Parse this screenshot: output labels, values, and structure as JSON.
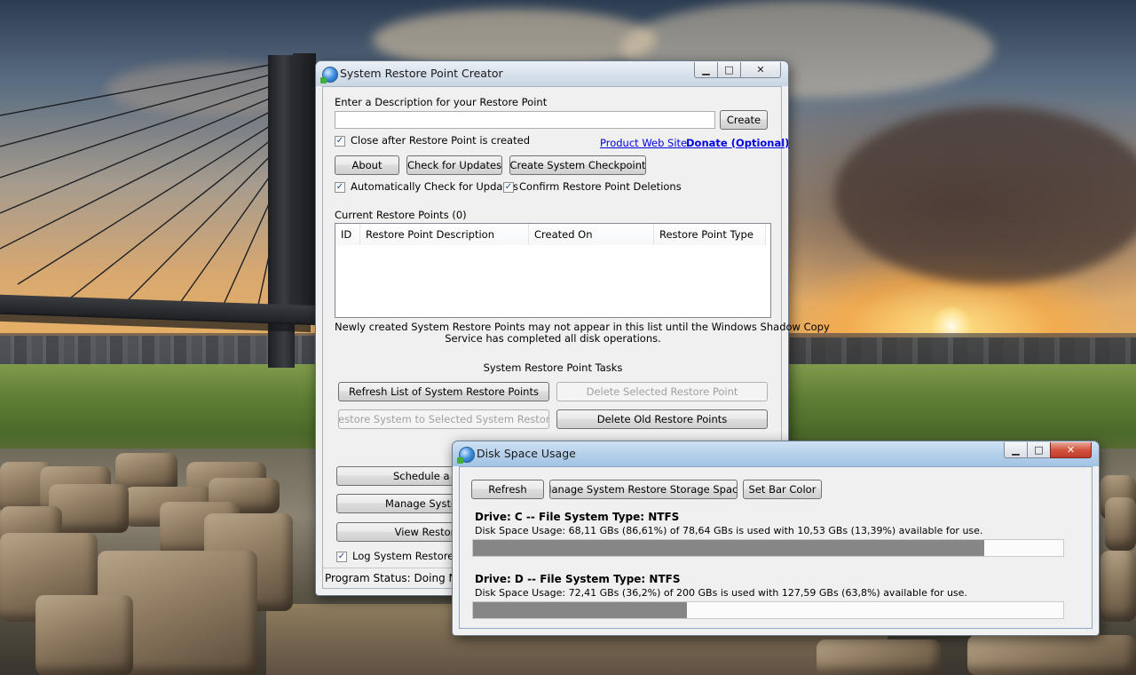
{
  "main_window": {
    "title": "System Restore Point Creator",
    "min_glyph": "▁",
    "max_glyph": "□",
    "close_glyph": "✕",
    "description_label": "Enter a Description for your Restore Point",
    "description_value": "",
    "create_button": "Create",
    "close_after_label": "Close after Restore Point is created",
    "close_after_checked": true,
    "product_link": "Product Web Site",
    "donate_link": "Donate (Optional)",
    "about_button": "About",
    "check_updates_button": "Check for Updates",
    "create_checkpoint_button": "Create System Checkpoint",
    "auto_check_label": "Automatically Check for Updates",
    "auto_check_checked": true,
    "confirm_delete_label": "Confirm Restore Point Deletions",
    "confirm_delete_checked": true,
    "current_points_label": "Current Restore Points (0)",
    "columns": [
      "ID",
      "Restore Point Description",
      "Created On",
      "Restore Point Type"
    ],
    "notice_line1": "Newly created System Restore Points may not appear in this list until the Windows Shadow Copy",
    "notice_line2": "Service has completed all disk operations.",
    "tasks_label": "System Restore Point Tasks",
    "refresh_list_button": "Refresh List of System Restore Points",
    "delete_selected_button": "Delete Selected Restore Point",
    "restore_system_button": "Restore System to Selected System Restore",
    "delete_old_button": "Delete Old Restore Points",
    "schedule_button": "Schedule a System",
    "manage_button": "Manage System Resto",
    "view_button": "View Restore Point",
    "log_label": "Log System Restore Poi",
    "log_checked": true,
    "status_text": "Program Status:  Doing No"
  },
  "disk_window": {
    "title": "Disk Space Usage",
    "min_glyph": "▁",
    "max_glyph": "□",
    "close_glyph": "✕",
    "refresh_button": "Refresh",
    "manage_storage_button": "Manage System Restore Storage Space",
    "bar_color_button": "Set Bar Color",
    "bar_color": "#868686",
    "drives": [
      {
        "heading": "Drive: C -- File System Type: NTFS",
        "usage": "Disk Space Usage: 68,11 GBs (86,61%) of 78,64 GBs is used with 10,53 GBs (13,39%) available for use.",
        "used_percent": 86.61
      },
      {
        "heading": "Drive: D -- File System Type: NTFS",
        "usage": "Disk Space Usage: 72,41 GBs (36,2%) of 200 GBs is used with 127,59 GBs (63,8%) available for use.",
        "used_percent": 36.2
      }
    ]
  }
}
